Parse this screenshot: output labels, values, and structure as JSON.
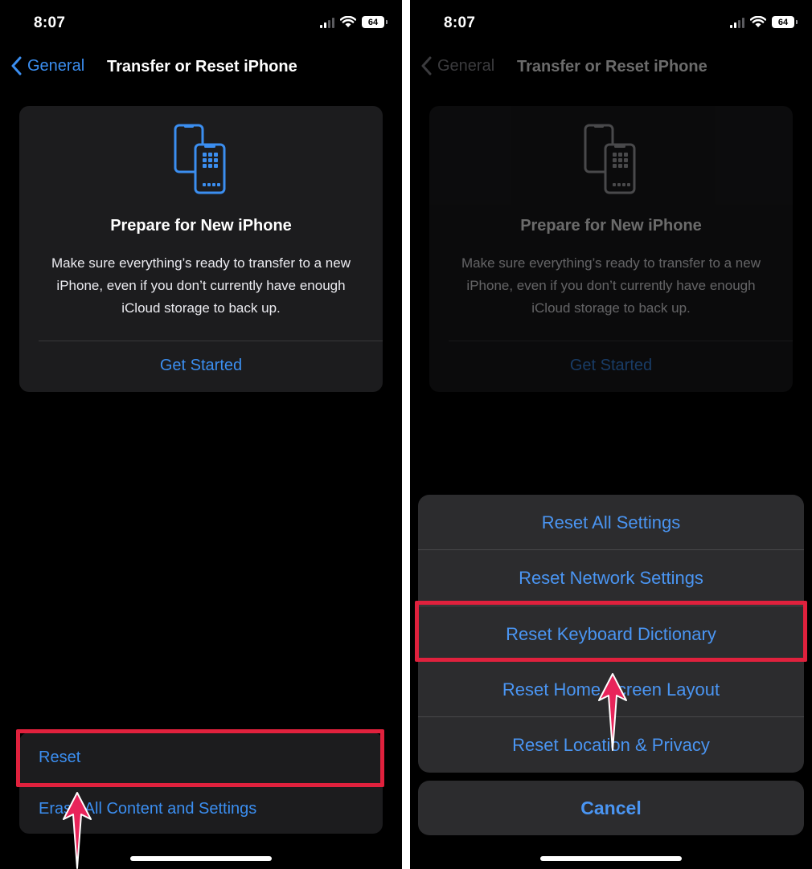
{
  "status": {
    "time": "8:07",
    "battery": "64"
  },
  "nav": {
    "back_label": "General",
    "title": "Transfer or Reset iPhone"
  },
  "card": {
    "title": "Prepare for New iPhone",
    "description": "Make sure everything’s ready to transfer to a new iPhone, even if you don’t currently have enough iCloud storage to back up.",
    "action": "Get Started"
  },
  "bottom_list": {
    "items": [
      "Reset",
      "Erase All Content and Settings"
    ]
  },
  "reset_sheet": {
    "items": [
      "Reset All Settings",
      "Reset Network Settings",
      "Reset Keyboard Dictionary",
      "Reset Home Screen Layout",
      "Reset Location & Privacy"
    ],
    "cancel": "Cancel",
    "highlighted_item": "Reset Keyboard Dictionary"
  },
  "colors": {
    "accent": "#3b8ef0",
    "highlight": "#e0213d",
    "arrow": "#e8245a"
  }
}
